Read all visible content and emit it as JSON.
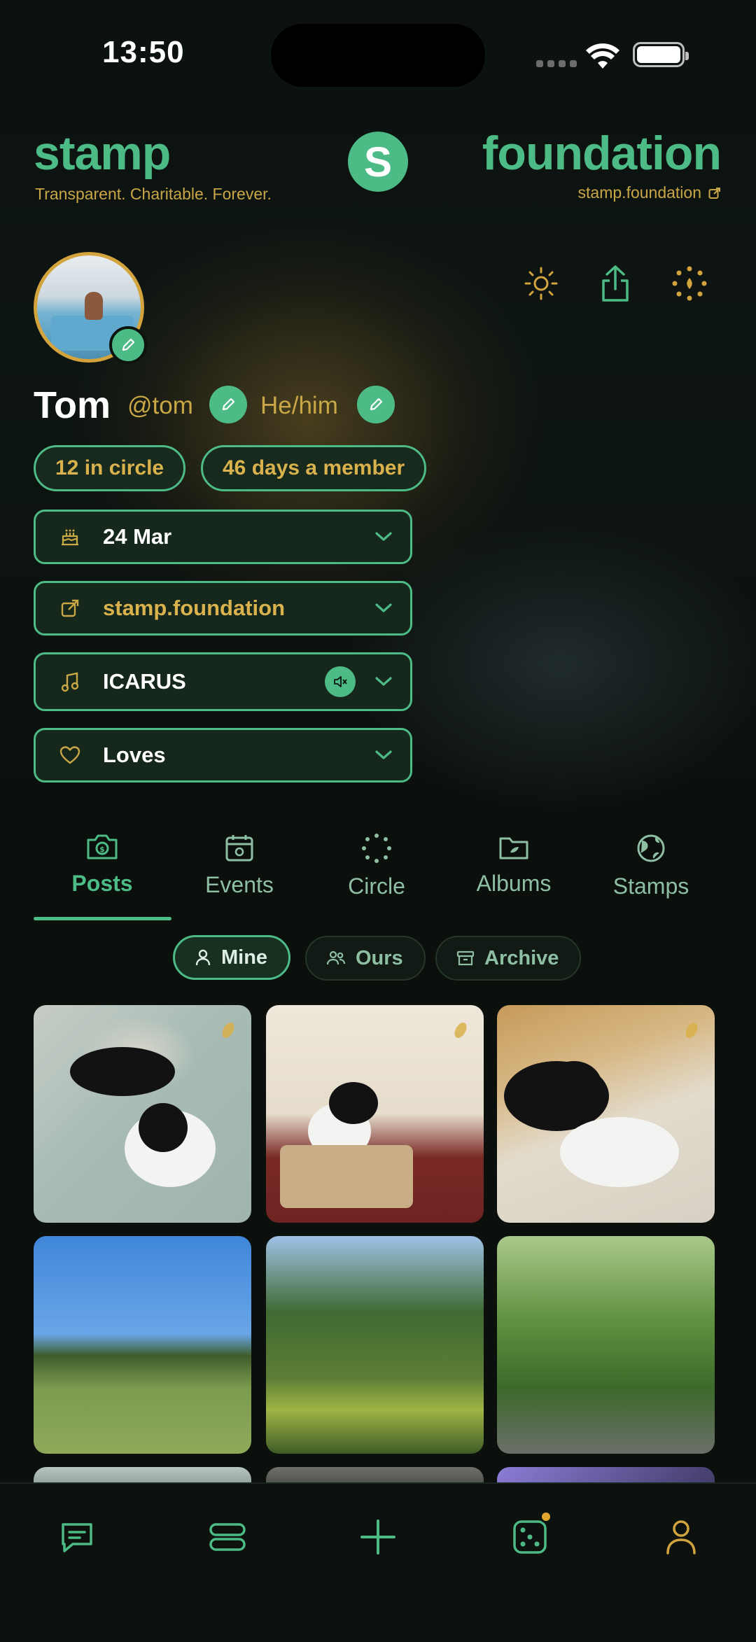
{
  "status_bar": {
    "time": "13:50"
  },
  "header": {
    "brand_left": "stamp",
    "tagline": "Transparent. Charitable. Forever.",
    "logo_letter": "S",
    "brand_right": "foundation",
    "site_link": "stamp.foundation"
  },
  "profile": {
    "name": "Tom",
    "handle": "@tom",
    "pronouns": "He/him",
    "chips": [
      "12 in circle",
      "46 days a member"
    ],
    "details": [
      {
        "icon": "cake-icon",
        "label": "24 Mar",
        "color": "#ffffff"
      },
      {
        "icon": "external-link-icon",
        "label": "stamp.foundation",
        "color": "#d9b24e"
      },
      {
        "icon": "music-note-icon",
        "label": "ICARUS",
        "color": "#ffffff"
      },
      {
        "icon": "heart-icon",
        "label": "Loves",
        "color": "#ffffff"
      }
    ]
  },
  "tabs": [
    {
      "label": "Posts",
      "icon": "camera-icon",
      "active": true
    },
    {
      "label": "Events",
      "icon": "calendar-icon",
      "active": false
    },
    {
      "label": "Circle",
      "icon": "dotted-circle-icon",
      "active": false
    },
    {
      "label": "Albums",
      "icon": "folder-icon",
      "active": false
    },
    {
      "label": "Stamps",
      "icon": "globe-icon",
      "active": false
    }
  ],
  "filters": [
    {
      "label": "Mine",
      "icon": "person-icon",
      "active": true
    },
    {
      "label": "Ours",
      "icon": "people-icon",
      "active": false
    },
    {
      "label": "Archive",
      "icon": "archive-icon",
      "active": false
    }
  ],
  "bottom_nav": [
    "chat-icon",
    "stack-icon",
    "plus-icon",
    "dice-icon",
    "profile-icon"
  ],
  "colors": {
    "accent": "#4dbb85",
    "gold": "#c9a646",
    "background": "#0b100d"
  }
}
